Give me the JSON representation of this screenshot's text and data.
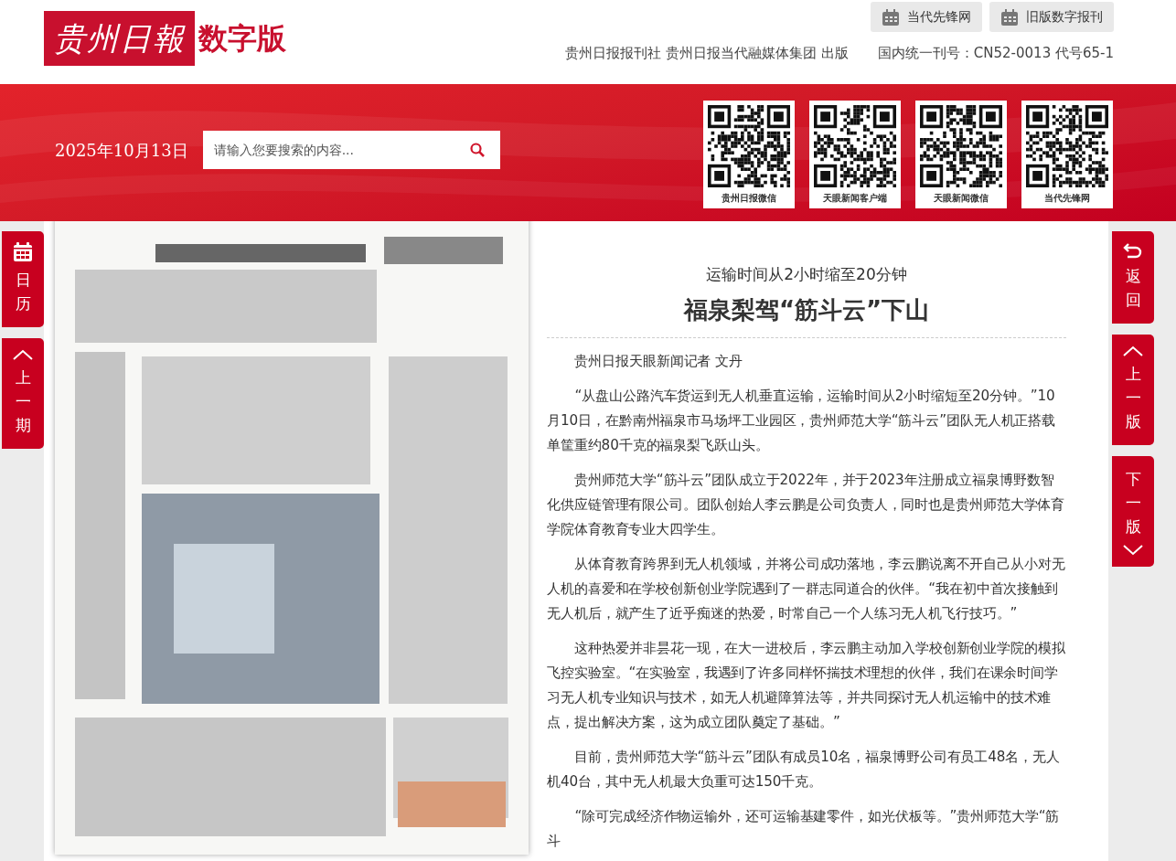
{
  "header": {
    "logo_text": "贵州日報",
    "edition": "数字版",
    "links": [
      {
        "label": "当代先锋网"
      },
      {
        "label": "旧版数字报刊"
      }
    ],
    "publisher": "贵州日报报刊社 贵州日报当代融媒体集团 出版",
    "serial": "国内统一刊号：CN52-0013 代号65-1"
  },
  "banner": {
    "date": "2025年10月13日",
    "search": {
      "placeholder": "请输入您要搜索的内容..."
    },
    "qr_codes": [
      {
        "caption": "贵州日报微信"
      },
      {
        "caption": "天眼新闻客户端"
      },
      {
        "caption": "天眼新闻微信"
      },
      {
        "caption": "当代先锋网"
      }
    ]
  },
  "left_nav": [
    {
      "label": "日历",
      "kind": "calendar"
    },
    {
      "label": "上一期",
      "kind": "up"
    }
  ],
  "right_nav": [
    {
      "label": "返回",
      "kind": "back"
    },
    {
      "label": "上一版",
      "kind": "up"
    },
    {
      "label": "下一版",
      "kind": "down"
    }
  ],
  "article": {
    "subtitle": "运输时间从2小时缩至20分钟",
    "title": "福泉梨驾“筋斗云”下山",
    "byline": "贵州日报天眼新闻记者 文丹",
    "paragraphs": [
      "“从盘山公路汽车货运到无人机垂直运输，运输时间从2小时缩短至20分钟。”10月10日，在黔南州福泉市马场坪工业园区，贵州师范大学“筋斗云”团队无人机正搭载单筐重约80千克的福泉梨飞跃山头。",
      "贵州师范大学“筋斗云”团队成立于2022年，并于2023年注册成立福泉博野数智化供应链管理有限公司。团队创始人李云鹏是公司负责人，同时也是贵州师范大学体育学院体育教育专业大四学生。",
      "从体育教育跨界到无人机领域，并将公司成功落地，李云鹏说离不开自己从小对无人机的喜爱和在学校创新创业学院遇到了一群志同道合的伙伴。“我在初中首次接触到无人机后，就产生了近乎痴迷的热爱，时常自己一个人练习无人机飞行技巧。”",
      "这种热爱并非昙花一现，在大一进校后，李云鹏主动加入学校创新创业学院的模拟飞控实验室。“在实验室，我遇到了许多同样怀揣技术理想的伙伴，我们在课余时间学习无人机专业知识与技术，如无人机避障算法等，并共同探讨无人机运输中的技术难点，提出解决方案，这为成立团队奠定了基础。”",
      "目前，贵州师范大学“筋斗云”团队有成员10名，福泉博野公司有员工48名，无人机40台，其中无人机最大负重可达150千克。",
      "“除可完成经济作物运输外，还可运输基建零件，如光伏板等。”贵州师范大学“筋斗"
    ]
  }
}
